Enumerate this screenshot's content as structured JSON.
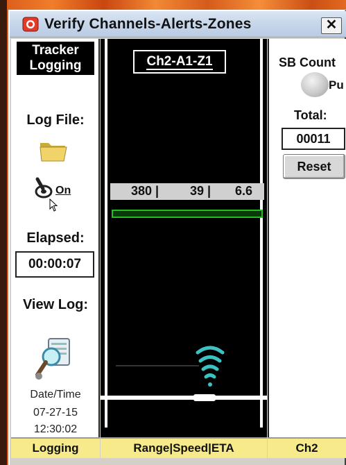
{
  "window": {
    "title": "Verify Channels-Alerts-Zones",
    "close_label": "✕"
  },
  "left": {
    "tracker_line1": "Tracker",
    "tracker_line2": "Logging",
    "log_file_label": "Log File:",
    "toggle_state": "On",
    "elapsed_label": "Elapsed:",
    "elapsed_value": "00:00:07",
    "view_log_label": "View Log:",
    "datetime_label": "Date/Time",
    "date_value": "07-27-15",
    "time_value": "12:30:02",
    "tab_label": "Logging"
  },
  "center": {
    "channel_label": "Ch2-A1-Z1",
    "readout": {
      "range": "380 |",
      "speed": "39 |",
      "eta": "6.6"
    },
    "tab_label": "Range|Speed|ETA"
  },
  "right": {
    "sb_count_label": "SB Count",
    "sb_indicator_text": "Pu",
    "total_label": "Total:",
    "total_value": "00011",
    "reset_label": "Reset",
    "tab_label": "Ch2"
  },
  "colors": {
    "accent_green": "#20c020",
    "tab_yellow": "#f7ea8a",
    "signal_teal": "#3cc2c2"
  }
}
